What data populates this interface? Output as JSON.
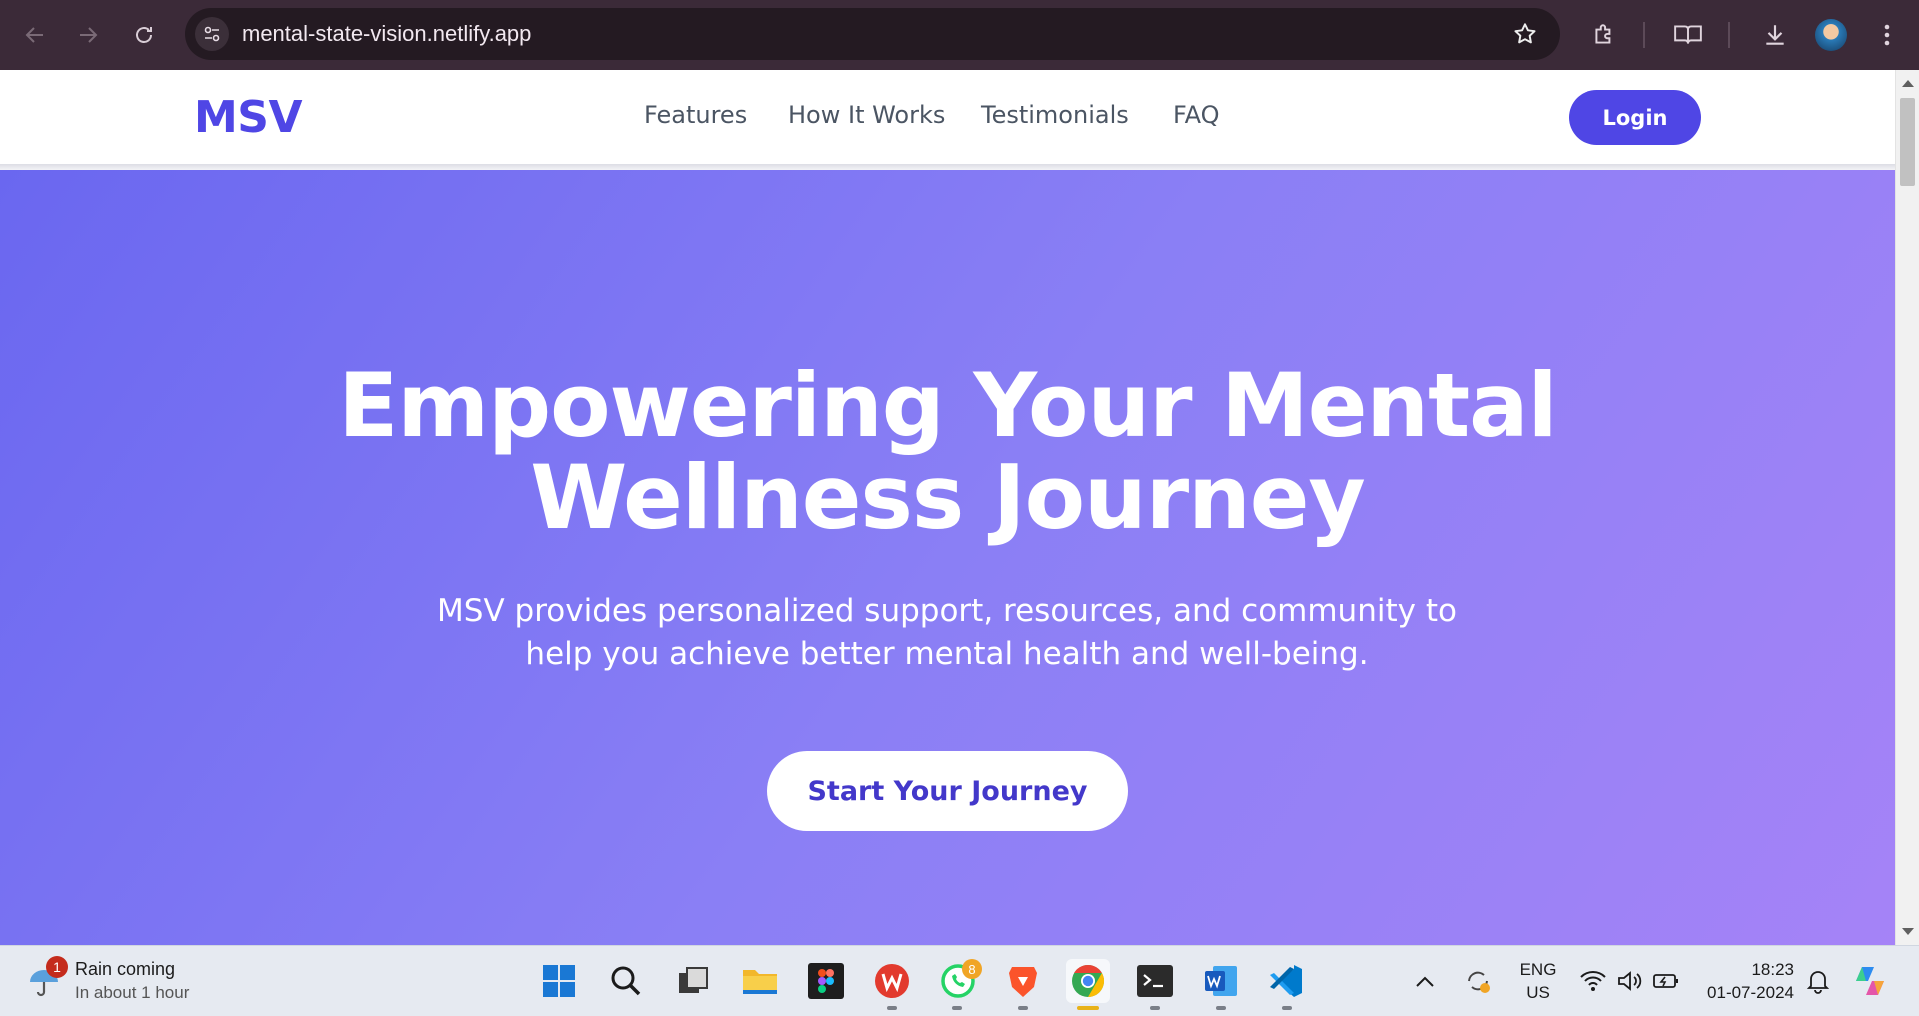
{
  "browser": {
    "url": "mental-state-vision.netlify.app",
    "icons": [
      "back-icon",
      "forward-icon",
      "reload-icon",
      "site-info-icon",
      "bookmark-star-icon",
      "extensions-icon",
      "reading-mode-icon",
      "download-icon",
      "profile-avatar",
      "menu-icon"
    ]
  },
  "site": {
    "logo": "MSV",
    "nav": [
      "Features",
      "How It Works",
      "Testimonials",
      "FAQ"
    ],
    "login_label": "Login",
    "accent": "#4f46e5"
  },
  "hero": {
    "title_line1": "Empowering Your Mental",
    "title_line2": "Wellness Journey",
    "subtitle_line1": "MSV provides personalized support, resources, and community to",
    "subtitle_line2": "help you achieve better mental health and well-being.",
    "cta_label": "Start Your Journey",
    "gradient": [
      "#6a67f0",
      "#a583f7"
    ]
  },
  "taskbar": {
    "weather_badge": "1",
    "weather_title": "Rain coming",
    "weather_sub": "In about 1 hour",
    "whatsapp_badge": "8",
    "lang_line1": "ENG",
    "lang_line2": "US",
    "time": "18:23",
    "date": "01-07-2024",
    "apps": [
      "start-icon",
      "search-icon",
      "task-view-icon",
      "file-explorer-icon",
      "figma-icon",
      "wps-office-icon",
      "whatsapp-icon",
      "brave-icon",
      "chrome-icon",
      "terminal-icon",
      "word-icon",
      "vscode-icon"
    ]
  }
}
